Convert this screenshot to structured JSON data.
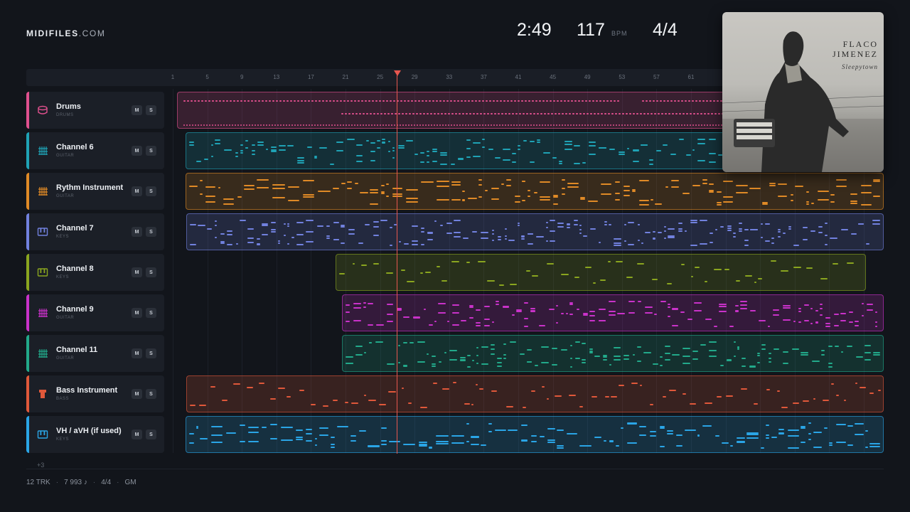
{
  "brand": {
    "name": "MIDIFILES",
    "domain": ".COM"
  },
  "transport": {
    "time": "2:49",
    "tempo": "117",
    "tempo_unit": "BPM",
    "signature": "4/4"
  },
  "ruler": {
    "marks": [
      "1",
      "5",
      "9",
      "13",
      "17",
      "21",
      "25",
      "29",
      "33",
      "37",
      "41",
      "45",
      "49",
      "53",
      "57",
      "61"
    ]
  },
  "playhead": {
    "bar": 26
  },
  "tracks": [
    {
      "name": "Drums",
      "type": "DRUMS",
      "icon": "drum-icon",
      "color": "#e0508e",
      "mute": "M",
      "solo": "S"
    },
    {
      "name": "Channel 6",
      "type": "GUITAR",
      "icon": "guitar-icon",
      "color": "#1fa2b5",
      "mute": "M",
      "solo": "S"
    },
    {
      "name": "Rythm Instrument",
      "type": "GUITAR",
      "icon": "guitar-icon",
      "color": "#e08a26",
      "mute": "M",
      "solo": "S"
    },
    {
      "name": "Channel 7",
      "type": "KEYS",
      "icon": "keys-icon",
      "color": "#7181de",
      "mute": "M",
      "solo": "S"
    },
    {
      "name": "Channel 8",
      "type": "KEYS",
      "icon": "keys-icon",
      "color": "#8aa51f",
      "mute": "M",
      "solo": "S"
    },
    {
      "name": "Channel 9",
      "type": "GUITAR",
      "icon": "guitar-icon",
      "color": "#c932c9",
      "mute": "M",
      "solo": "S"
    },
    {
      "name": "Channel 11",
      "type": "GUITAR",
      "icon": "guitar-icon",
      "color": "#22a98a",
      "mute": "M",
      "solo": "S"
    },
    {
      "name": "Bass Instrument",
      "type": "BASS",
      "icon": "bass-icon",
      "color": "#e0583a",
      "mute": "M",
      "solo": "S"
    },
    {
      "name": "VH / aVH (if used)",
      "type": "KEYS",
      "icon": "keys-icon",
      "color": "#2aa5e6",
      "mute": "M",
      "solo": "S"
    }
  ],
  "more_tracks": "+3",
  "footer": {
    "tracks": "12 TRK",
    "notes": "7 993 ♪",
    "signature": "4/4",
    "standard": "GM"
  },
  "album": {
    "artist_line1": "FLACO",
    "artist_line2": "JIMENEZ",
    "title": "Sleepytown"
  }
}
